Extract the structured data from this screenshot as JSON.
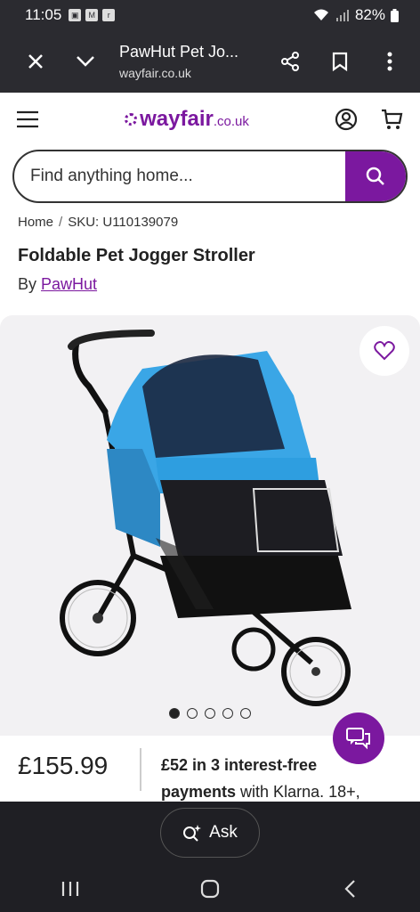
{
  "status": {
    "time": "11:05",
    "battery": "82%",
    "notif_icons": [
      "gallery-icon",
      "gmail-icon",
      "ring-icon"
    ]
  },
  "browser": {
    "title": "PawHut Pet Jo...",
    "url": "wayfair.co.uk"
  },
  "header": {
    "logo_text": "wayfair",
    "logo_domain": ".co.uk"
  },
  "search": {
    "placeholder": "Find anything home..."
  },
  "breadcrumb": {
    "home": "Home",
    "separator": "/",
    "sku": "SKU: U110139079"
  },
  "product": {
    "title": "Foldable Pet Jogger Stroller",
    "by_label": "By",
    "brand": "PawHut",
    "price": "£155.99",
    "klarna_bold1": "£52 in 3 interest-free",
    "klarna_bold2": "payments",
    "klarna_rest": " with Klarna. 18+,"
  },
  "carousel": {
    "count": 5,
    "active": 0
  },
  "ask": {
    "label": "Ask"
  },
  "colors": {
    "accent": "#7b189f",
    "chrome": "#2b2b30",
    "stroller_blue": "#3aa6e6"
  }
}
